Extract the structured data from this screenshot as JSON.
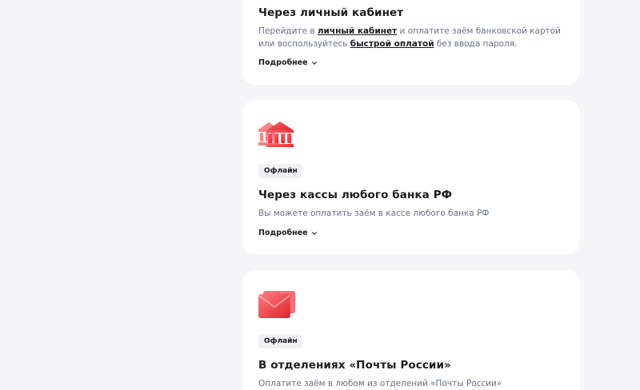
{
  "cards": [
    {
      "title": "Через личный кабинет",
      "desc_part1": "Перейдите в ",
      "desc_link1": "личный кабинет",
      "desc_part2": " и оплатите заём банковской картой или воспользуйтесь ",
      "desc_link2": "быстрой оплатой",
      "desc_part3": " без ввода пароля.",
      "more_label": "Подробнее",
      "icon": "account-icon"
    },
    {
      "title": "Через кассы любого банка РФ",
      "badge": "Офлайн",
      "desc": "Вы можете оплатить заём в кассе любого банка РФ",
      "more_label": "Подробнее",
      "icon": "bank-icon"
    },
    {
      "title": "В отделениях «Почты России»",
      "badge": "Офлайн",
      "desc": "Оплатите заём в любом из отделений «Почты России»",
      "icon": "envelope-icon"
    }
  ],
  "colors": {
    "accent": "#e8343c",
    "background": "#f5f5f7",
    "card": "#ffffff",
    "muted_text": "#6b6f82",
    "badge_bg": "#f1f1f4"
  }
}
